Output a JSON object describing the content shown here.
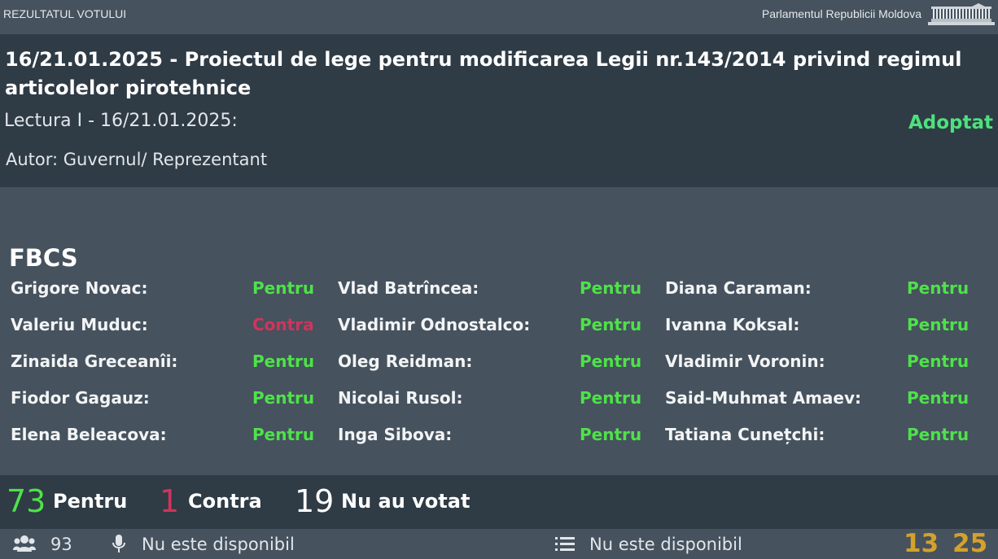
{
  "topbar": {
    "left_label": "REZULTATUL VOTULUI",
    "right_label": "Parlamentul Republicii Moldova",
    "logo_icon": "parliament-building-icon"
  },
  "header": {
    "title": "16/21.01.2025 - Proiectul de lege pentru modificarea Legii nr.143/2014 privind regimul articolelor pirotehnice",
    "reading": "Lectura I - 16/21.01.2025:",
    "status": "Adoptat",
    "author": "Autor: Guvernul/ Reprezentant"
  },
  "faction": "FBCS",
  "rows": [
    [
      {
        "name": "Grigore Novac:",
        "vote": "Pentru"
      },
      {
        "name": "Vlad Batrîncea:",
        "vote": "Pentru"
      },
      {
        "name": "Diana Caraman:",
        "vote": "Pentru"
      }
    ],
    [
      {
        "name": "Valeriu Muduc:",
        "vote": "Contra"
      },
      {
        "name": "Vladimir Odnostalco:",
        "vote": "Pentru"
      },
      {
        "name": "Ivanna Koksal:",
        "vote": "Pentru"
      }
    ],
    [
      {
        "name": "Zinaida Greceanîi:",
        "vote": "Pentru"
      },
      {
        "name": "Oleg Reidman:",
        "vote": "Pentru"
      },
      {
        "name": "Vladimir Voronin:",
        "vote": "Pentru"
      }
    ],
    [
      {
        "name": "Fiodor Gagauz:",
        "vote": "Pentru"
      },
      {
        "name": "Nicolai Rusol:",
        "vote": "Pentru"
      },
      {
        "name": "Said-Muhmat Amaev:",
        "vote": "Pentru"
      }
    ],
    [
      {
        "name": "Elena Beleacova:",
        "vote": "Pentru"
      },
      {
        "name": "Inga Sibova:",
        "vote": "Pentru"
      },
      {
        "name": "Tatiana Cunețchi:",
        "vote": "Pentru"
      }
    ]
  ],
  "summary": {
    "pentru_count": "73",
    "pentru_label": "Pentru",
    "contra_count": "1",
    "contra_label": "Contra",
    "nu_count": "19",
    "nu_label": "Nu au votat"
  },
  "footer": {
    "people_count": "93",
    "mic_status": "Nu este disponibil",
    "list_status": "Nu este disponibil",
    "timer_minutes": "13",
    "timer_seconds": "25"
  },
  "colors": {
    "pentru": "#4ee24a",
    "contra": "#d2335c",
    "adoptat": "#4ee07d",
    "timer": "#d4a12a"
  }
}
